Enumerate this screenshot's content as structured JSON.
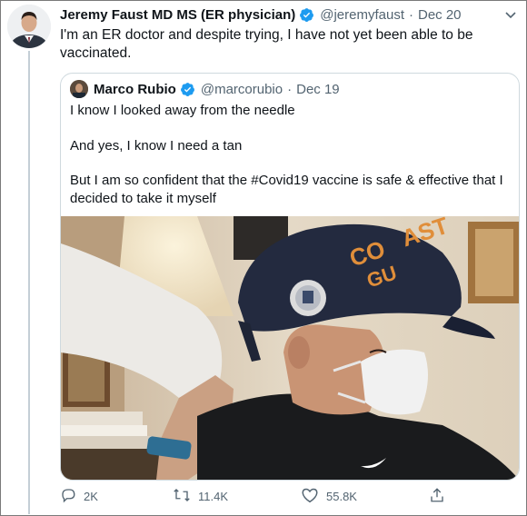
{
  "tweet": {
    "author_name": "Jeremy Faust MD MS (ER physician)",
    "handle": "@jeremyfaust",
    "separator": "·",
    "date": "Dec 20",
    "text": "I'm an ER doctor and despite trying, I have not yet been able to be vaccinated."
  },
  "quoted_tweet": {
    "author_name": "Marco Rubio",
    "handle": "@marcorubio",
    "separator": "·",
    "date": "Dec 19",
    "paragraphs": [
      "I know I looked away from the needle",
      "And yes, I know I need a tan",
      "But I am so confident that the #Covid19 vaccine is safe & effective that I decided to take it myself"
    ],
    "photo_icon": "photo-of-man-receiving-vaccine"
  },
  "actions": {
    "reply_count": "2K",
    "retweet_count": "11.4K",
    "like_count": "55.8K"
  },
  "icons": {
    "verified": "verified-badge-icon",
    "caret": "chevron-down-icon",
    "reply": "reply-icon",
    "retweet": "retweet-icon",
    "like": "heart-icon",
    "share": "share-icon"
  },
  "colors": {
    "verified_blue": "#1d9bf0",
    "secondary_text": "#536471",
    "primary_text": "#0f1419",
    "border": "#cfd9de"
  }
}
